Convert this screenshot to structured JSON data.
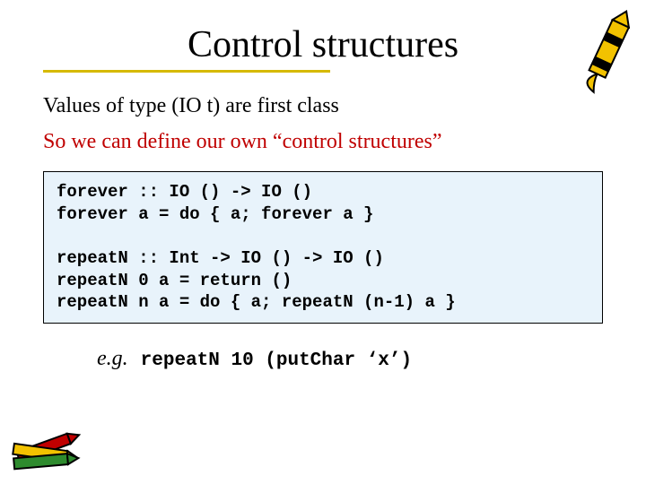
{
  "title": "Control structures",
  "line1": "Values of type (IO t) are first class",
  "line2": "So we can define our own “control structures”",
  "code": "forever :: IO () -> IO ()\nforever a = do { a; forever a }\n\nrepeatN :: Int -> IO () -> IO ()\nrepeatN 0 a = return ()\nrepeatN n a = do { a; repeatN (n-1) a }",
  "example_prefix": "e.g.",
  "example_code": "repeatN 10 (putChar ‘x’)",
  "colors": {
    "accent": "#d6b900",
    "code_bg": "#e8f3fb",
    "red": "#c00000"
  },
  "icons": {
    "top_right": "yellow-crayon-icon",
    "bottom_left": "crayons-cluster-icon"
  }
}
